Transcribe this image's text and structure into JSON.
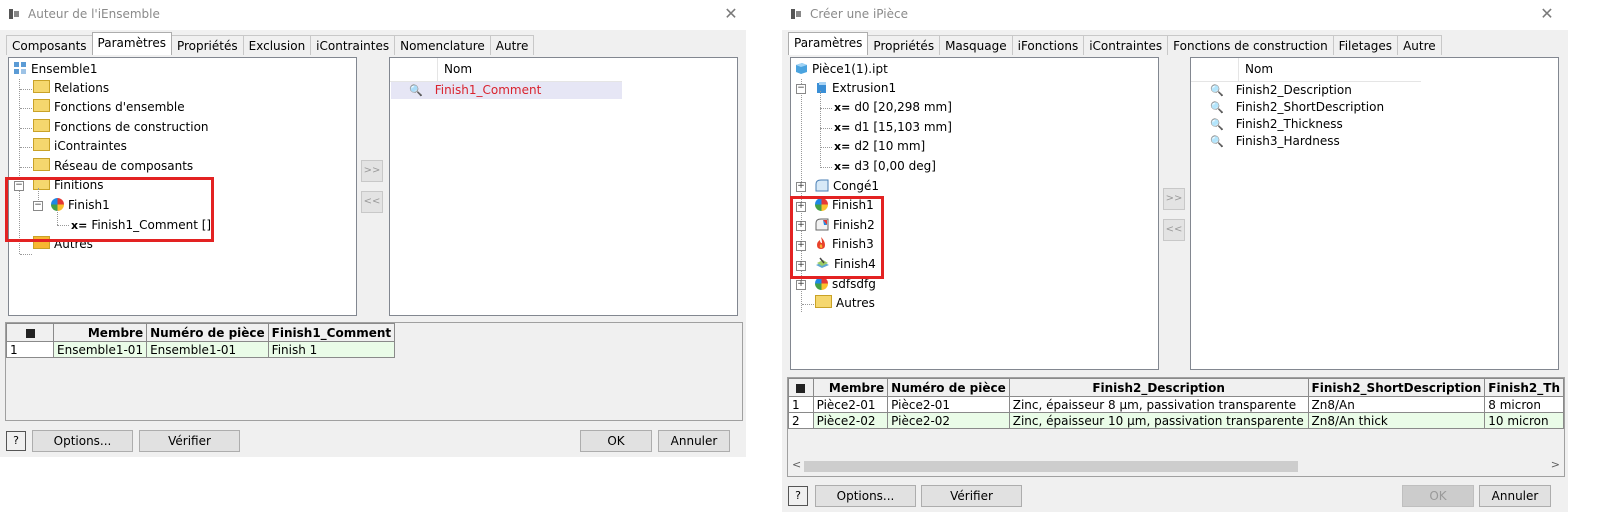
{
  "left_dialog": {
    "title": "Auteur de l'iEnsemble",
    "tabs": [
      "Composants",
      "Paramètres",
      "Propriétés",
      "Exclusion",
      "iContraintes",
      "Nomenclature",
      "Autre"
    ],
    "tree": {
      "root": "Ensemble1",
      "items": [
        "Relations",
        "Fonctions d'ensemble",
        "Fonctions de construction",
        "iContraintes",
        "Réseau de composants",
        "Finitions"
      ],
      "finish": "Finish1",
      "param": "Finish1_Comment []",
      "last": "Autres",
      "param_prefix": "x="
    },
    "move_right": ">>",
    "move_left": "<<",
    "list_header": "Nom",
    "list_items": [
      "Finish1_Comment"
    ],
    "grid": {
      "headers": [
        "Membre",
        "Numéro de pièce",
        "Finish1_Comment"
      ],
      "rows": [
        [
          "1",
          "Ensemble1-01",
          "Ensemble1-01",
          "Finish 1"
        ]
      ]
    },
    "buttons": {
      "options": "Options...",
      "verify": "Vérifier",
      "ok": "OK",
      "cancel": "Annuler"
    },
    "highlight_color": "#e32222"
  },
  "right_dialog": {
    "title": "Créer une iPièce",
    "tabs": [
      "Paramètres",
      "Propriétés",
      "Masquage",
      "iFonctions",
      "iContraintes",
      "Fonctions de construction",
      "Filetages",
      "Autre"
    ],
    "tree": {
      "root": "Pièce1(1).ipt",
      "extrusion": "Extrusion1",
      "params": [
        "d0 [20,298 mm]",
        "d1 [15,103 mm]",
        "d2 [10 mm]",
        "d3 [0,00 deg]"
      ],
      "fillet": "Congé1",
      "finishes": [
        "Finish1",
        "Finish2",
        "Finish3",
        "Finish4"
      ],
      "other": "sdfsdfg",
      "last": "Autres"
    },
    "list_header": "Nom",
    "list_items": [
      "Finish2_Description",
      "Finish2_ShortDescription",
      "Finish2_Thickness",
      "Finish3_Hardness"
    ],
    "grid": {
      "headers": [
        "Membre",
        "Numéro de pièce",
        "Finish2_Description",
        "Finish2_ShortDescription",
        "Finish2_Th"
      ],
      "rows": [
        [
          "1",
          "Pièce2-01",
          "Pièce2-01",
          "Zinc, épaisseur 8 µm, passivation transparente",
          "Zn8/An",
          "8 micron"
        ],
        [
          "2",
          "Pièce2-02",
          "Pièce2-02",
          "Zinc, épaisseur 10 µm, passivation transparente",
          "Zn8/An thick",
          "10 micron"
        ]
      ]
    }
  }
}
